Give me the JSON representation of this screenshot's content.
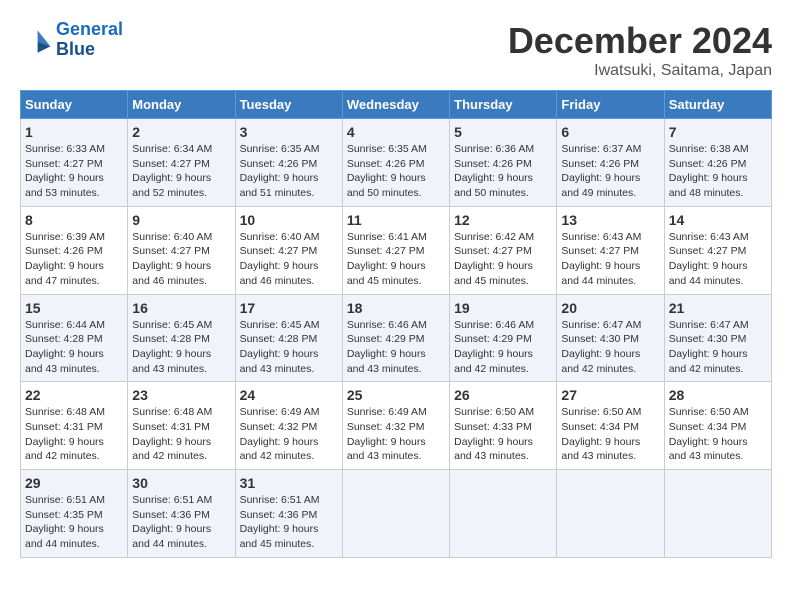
{
  "header": {
    "logo_line1": "General",
    "logo_line2": "Blue",
    "month": "December 2024",
    "location": "Iwatsuki, Saitama, Japan"
  },
  "days_of_week": [
    "Sunday",
    "Monday",
    "Tuesday",
    "Wednesday",
    "Thursday",
    "Friday",
    "Saturday"
  ],
  "weeks": [
    [
      {
        "day": "1",
        "sunrise": "6:33 AM",
        "sunset": "4:27 PM",
        "daylight": "9 hours and 53 minutes."
      },
      {
        "day": "2",
        "sunrise": "6:34 AM",
        "sunset": "4:27 PM",
        "daylight": "9 hours and 52 minutes."
      },
      {
        "day": "3",
        "sunrise": "6:35 AM",
        "sunset": "4:26 PM",
        "daylight": "9 hours and 51 minutes."
      },
      {
        "day": "4",
        "sunrise": "6:35 AM",
        "sunset": "4:26 PM",
        "daylight": "9 hours and 50 minutes."
      },
      {
        "day": "5",
        "sunrise": "6:36 AM",
        "sunset": "4:26 PM",
        "daylight": "9 hours and 50 minutes."
      },
      {
        "day": "6",
        "sunrise": "6:37 AM",
        "sunset": "4:26 PM",
        "daylight": "9 hours and 49 minutes."
      },
      {
        "day": "7",
        "sunrise": "6:38 AM",
        "sunset": "4:26 PM",
        "daylight": "9 hours and 48 minutes."
      }
    ],
    [
      {
        "day": "8",
        "sunrise": "6:39 AM",
        "sunset": "4:26 PM",
        "daylight": "9 hours and 47 minutes."
      },
      {
        "day": "9",
        "sunrise": "6:40 AM",
        "sunset": "4:27 PM",
        "daylight": "9 hours and 46 minutes."
      },
      {
        "day": "10",
        "sunrise": "6:40 AM",
        "sunset": "4:27 PM",
        "daylight": "9 hours and 46 minutes."
      },
      {
        "day": "11",
        "sunrise": "6:41 AM",
        "sunset": "4:27 PM",
        "daylight": "9 hours and 45 minutes."
      },
      {
        "day": "12",
        "sunrise": "6:42 AM",
        "sunset": "4:27 PM",
        "daylight": "9 hours and 45 minutes."
      },
      {
        "day": "13",
        "sunrise": "6:43 AM",
        "sunset": "4:27 PM",
        "daylight": "9 hours and 44 minutes."
      },
      {
        "day": "14",
        "sunrise": "6:43 AM",
        "sunset": "4:27 PM",
        "daylight": "9 hours and 44 minutes."
      }
    ],
    [
      {
        "day": "15",
        "sunrise": "6:44 AM",
        "sunset": "4:28 PM",
        "daylight": "9 hours and 43 minutes."
      },
      {
        "day": "16",
        "sunrise": "6:45 AM",
        "sunset": "4:28 PM",
        "daylight": "9 hours and 43 minutes."
      },
      {
        "day": "17",
        "sunrise": "6:45 AM",
        "sunset": "4:28 PM",
        "daylight": "9 hours and 43 minutes."
      },
      {
        "day": "18",
        "sunrise": "6:46 AM",
        "sunset": "4:29 PM",
        "daylight": "9 hours and 43 minutes."
      },
      {
        "day": "19",
        "sunrise": "6:46 AM",
        "sunset": "4:29 PM",
        "daylight": "9 hours and 42 minutes."
      },
      {
        "day": "20",
        "sunrise": "6:47 AM",
        "sunset": "4:30 PM",
        "daylight": "9 hours and 42 minutes."
      },
      {
        "day": "21",
        "sunrise": "6:47 AM",
        "sunset": "4:30 PM",
        "daylight": "9 hours and 42 minutes."
      }
    ],
    [
      {
        "day": "22",
        "sunrise": "6:48 AM",
        "sunset": "4:31 PM",
        "daylight": "9 hours and 42 minutes."
      },
      {
        "day": "23",
        "sunrise": "6:48 AM",
        "sunset": "4:31 PM",
        "daylight": "9 hours and 42 minutes."
      },
      {
        "day": "24",
        "sunrise": "6:49 AM",
        "sunset": "4:32 PM",
        "daylight": "9 hours and 42 minutes."
      },
      {
        "day": "25",
        "sunrise": "6:49 AM",
        "sunset": "4:32 PM",
        "daylight": "9 hours and 43 minutes."
      },
      {
        "day": "26",
        "sunrise": "6:50 AM",
        "sunset": "4:33 PM",
        "daylight": "9 hours and 43 minutes."
      },
      {
        "day": "27",
        "sunrise": "6:50 AM",
        "sunset": "4:34 PM",
        "daylight": "9 hours and 43 minutes."
      },
      {
        "day": "28",
        "sunrise": "6:50 AM",
        "sunset": "4:34 PM",
        "daylight": "9 hours and 43 minutes."
      }
    ],
    [
      {
        "day": "29",
        "sunrise": "6:51 AM",
        "sunset": "4:35 PM",
        "daylight": "9 hours and 44 minutes."
      },
      {
        "day": "30",
        "sunrise": "6:51 AM",
        "sunset": "4:36 PM",
        "daylight": "9 hours and 44 minutes."
      },
      {
        "day": "31",
        "sunrise": "6:51 AM",
        "sunset": "4:36 PM",
        "daylight": "9 hours and 45 minutes."
      },
      null,
      null,
      null,
      null
    ]
  ]
}
